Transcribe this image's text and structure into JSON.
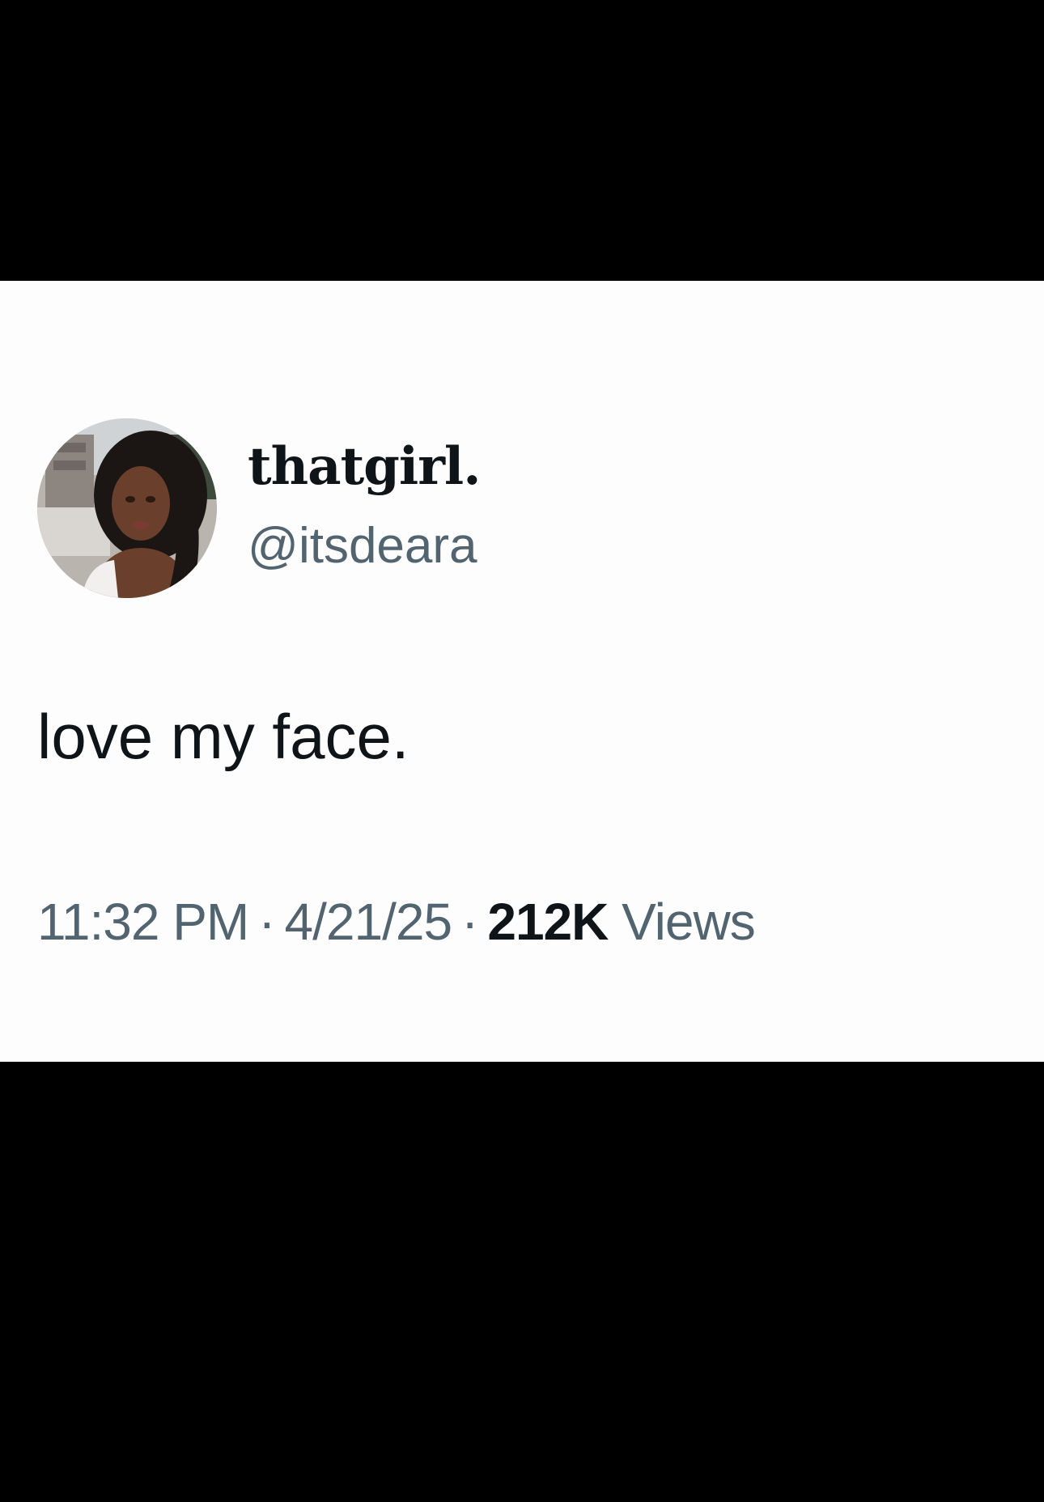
{
  "tweet": {
    "display_name": "thatgirl.",
    "handle": "@itsdeara",
    "text": "love my face.",
    "time": "11:32 PM",
    "date": "4/21/25",
    "separator": "·",
    "views_count": "212K",
    "views_label": "Views"
  },
  "icons": {
    "avatar": "profile-photo"
  },
  "colors": {
    "background": "#000000",
    "card": "#fdfdfd",
    "primary_text": "#0f1419",
    "secondary_text": "#536471"
  }
}
